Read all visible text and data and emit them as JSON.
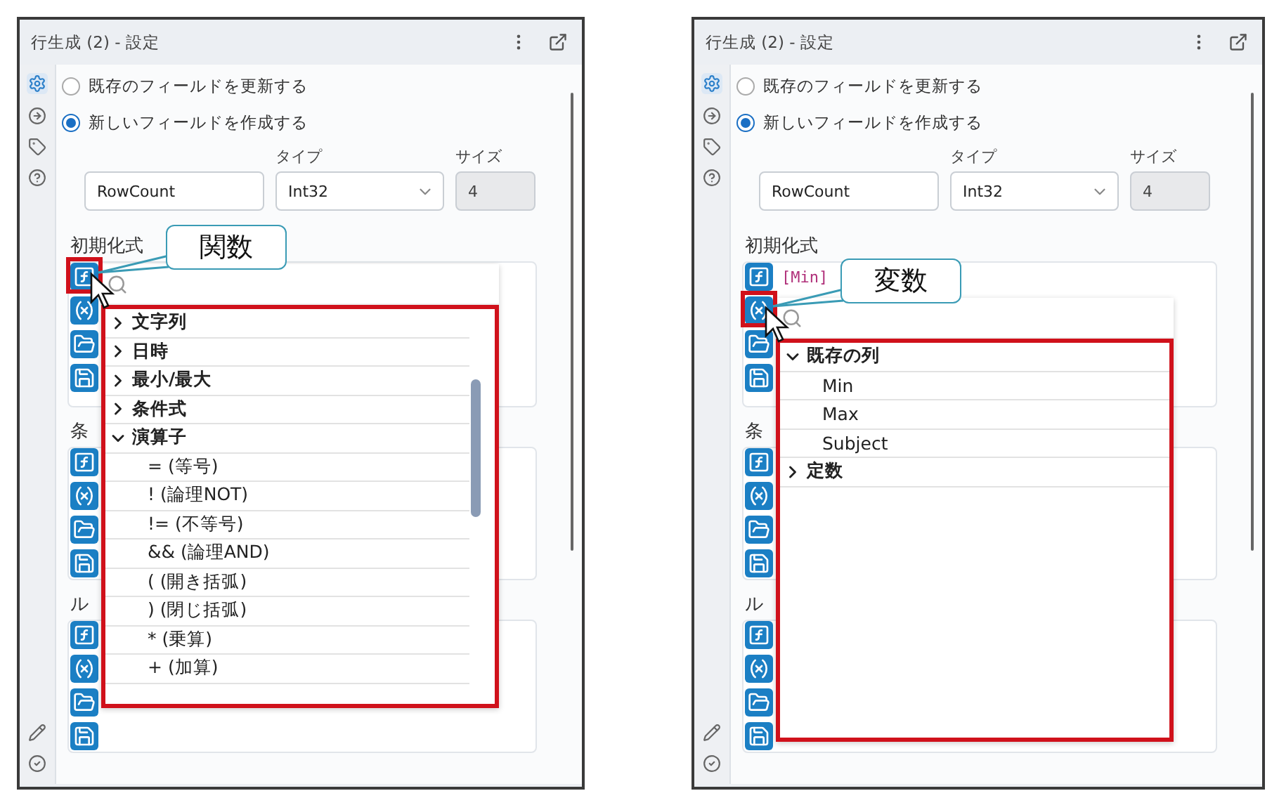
{
  "panels": [
    {
      "title": "行生成 (2) - 設定",
      "options": [
        {
          "label": "既存のフィールドを更新する",
          "selected": false
        },
        {
          "label": "新しいフィールドを作成する",
          "selected": true
        }
      ],
      "field_name": {
        "value": "RowCount"
      },
      "type": {
        "label": "タイプ",
        "value": "Int32"
      },
      "size": {
        "label": "サイズ",
        "value": "4",
        "disabled": true
      },
      "sections": [
        {
          "label": "初期化式"
        },
        {
          "label": "条"
        },
        {
          "label": "ル"
        }
      ],
      "menu": {
        "kind": "functions",
        "callout": "関数",
        "items": [
          {
            "label": "文字列",
            "expanded": false
          },
          {
            "label": "日時",
            "expanded": false
          },
          {
            "label": "最小/最大",
            "expanded": false
          },
          {
            "label": "条件式",
            "expanded": false
          },
          {
            "label": "演算子",
            "expanded": true,
            "children": [
              {
                "label": "= (等号)"
              },
              {
                "label": "! (論理NOT)"
              },
              {
                "label": "!= (不等号)"
              },
              {
                "label": "&& (論理AND)"
              },
              {
                "label": "( (開き括弧)"
              },
              {
                "label": ") (閉じ括弧)"
              },
              {
                "label": "* (乗算)"
              },
              {
                "label": "+ (加算)"
              }
            ]
          }
        ]
      }
    },
    {
      "title": "行生成 (2) - 設定",
      "options": [
        {
          "label": "既存のフィールドを更新する",
          "selected": false
        },
        {
          "label": "新しいフィールドを作成する",
          "selected": true
        }
      ],
      "field_name": {
        "value": "RowCount"
      },
      "type": {
        "label": "タイプ",
        "value": "Int32"
      },
      "size": {
        "label": "サイズ",
        "value": "4",
        "disabled": true
      },
      "sections": [
        {
          "label": "初期化式",
          "expression": "[Min]"
        },
        {
          "label": "条"
        },
        {
          "label": "ル"
        }
      ],
      "menu": {
        "kind": "variables",
        "callout": "変数",
        "items": [
          {
            "label": "既存の列",
            "expanded": true,
            "children": [
              {
                "label": "Min"
              },
              {
                "label": "Max"
              },
              {
                "label": "Subject"
              }
            ]
          },
          {
            "label": "定数",
            "expanded": false
          }
        ]
      }
    }
  ]
}
